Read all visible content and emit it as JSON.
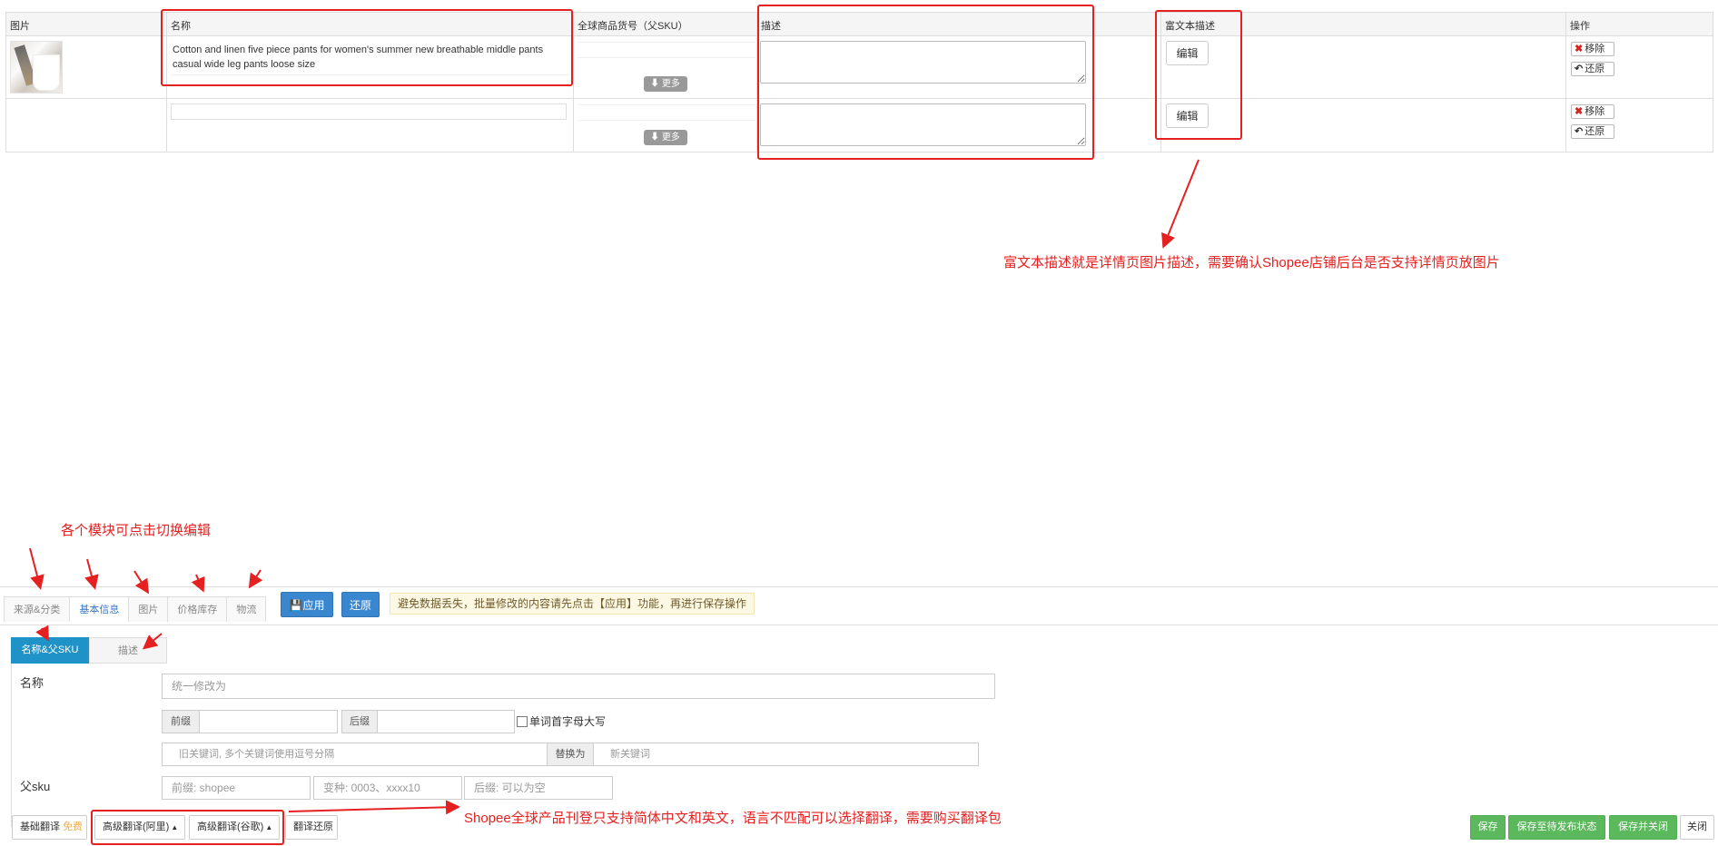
{
  "table": {
    "headers": {
      "image": "图片",
      "name": "名称",
      "global_sku": "全球商品货号（父SKU）",
      "description": "描述",
      "rich_description": "富文本描述",
      "actions": "操作"
    },
    "rows": [
      {
        "name": "Cotton and linen five piece pants for women's summer new breathable middle pants casual wide leg pants loose size",
        "more_label": "更多",
        "edit_label": "编辑",
        "remove_label": "移除",
        "restore_label": "还原"
      },
      {
        "name": "",
        "more_label": "更多",
        "edit_label": "编辑",
        "remove_label": "移除",
        "restore_label": "还原"
      }
    ]
  },
  "annotations": {
    "rich_text_note": "富文本描述就是详情页图片描述，需要确认Shopee店铺后台是否支持详情页放图片",
    "modules_note": "各个模块可点击切换编辑",
    "translate_note": "Shopee全球产品刊登只支持简体中文和英文，语言不匹配可以选择翻译，需要购买翻译包"
  },
  "editor": {
    "tabs": [
      "来源&分类",
      "基本信息",
      "图片",
      "价格库存",
      "物流"
    ],
    "active_tab": "基本信息",
    "apply_label": "应用",
    "restore_label": "还原",
    "notice": "避免数据丢失，批量修改的内容请先点击【应用】功能，再进行保存操作",
    "subtabs": [
      "名称&父SKU",
      "描述"
    ],
    "name_label": "名称",
    "name_placeholder": "统一修改为",
    "prefix_label": "前缀",
    "suffix_label": "后缀",
    "capitalize_label": "单词首字母大写",
    "old_keyword_placeholder": "旧关键词, 多个关键词使用逗号分隔",
    "replace_label": "替换为",
    "new_keyword_placeholder": "新关键词",
    "parent_sku_label": "父sku",
    "sku_prefix_placeholder": "前缀: shopee",
    "sku_variant_placeholder": "变种: 0003、xxxx10",
    "sku_suffix_placeholder": "后缀: 可以为空"
  },
  "footer": {
    "basic_translate": "基础翻译",
    "free_badge": "免费",
    "adv_translate_ali": "高级翻译(阿里)",
    "adv_translate_google": "高级翻译(谷歌)",
    "translate_restore": "翻译还原",
    "save": "保存",
    "save_pending": "保存至待发布状态",
    "save_close": "保存并关闭",
    "close": "关闭"
  },
  "colors": {
    "annotation_red": "#e52020",
    "primary_blue": "#3a87d0",
    "active_subtab": "#1f93c8",
    "success_green": "#5cb85c",
    "free_orange": "#f0ad4e"
  }
}
